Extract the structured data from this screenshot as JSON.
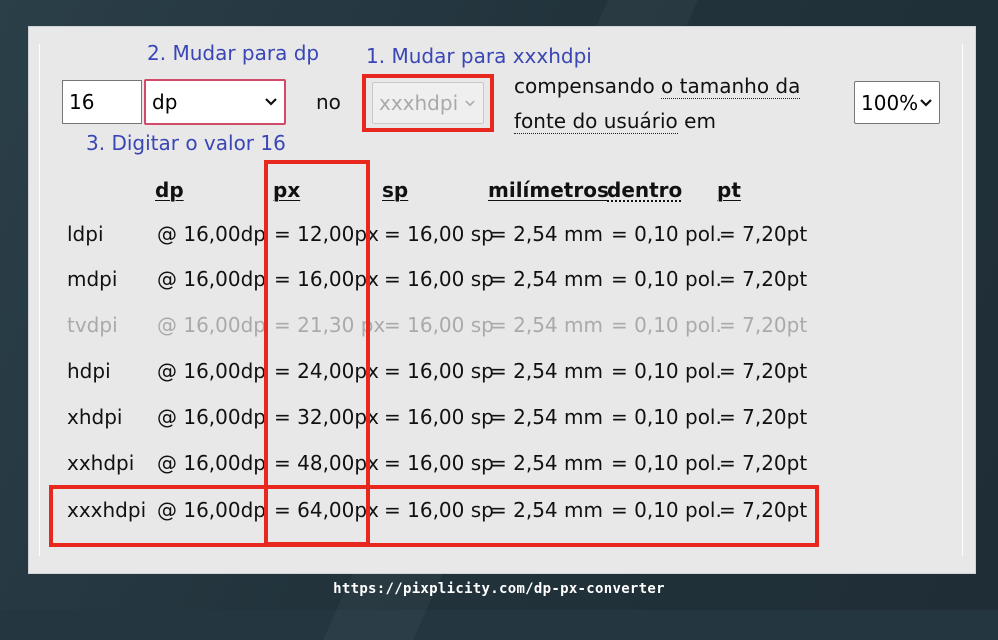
{
  "annotations": {
    "step1": "1. Mudar para xxxhdpi",
    "step2": "2. Mudar para dp",
    "step3": "3. Digitar o valor 16"
  },
  "converter": {
    "value_input": "16",
    "unit_select": {
      "selected": "dp"
    },
    "word_no": "no",
    "density_select": {
      "selected": "xxxhdpi"
    },
    "compensating_prefix": "compensando ",
    "compensating_link": "o tamanho da fonte do usuário",
    "compensating_suffix": " em",
    "zoom_select": {
      "selected": "100%"
    }
  },
  "table": {
    "headers": {
      "dp": "dp",
      "px": "px",
      "sp": "sp",
      "mm": "milímetros",
      "inches": "dentro",
      "pt": "pt"
    },
    "rows": [
      {
        "name": "ldpi",
        "dp": "@ 16,00dp",
        "px": "= 12,00px",
        "sp": "= 16,00 sp",
        "mm": "= 2,54 mm",
        "in": "= 0,10 pol.",
        "pt": "= 7,20pt",
        "dimmed": false
      },
      {
        "name": "mdpi",
        "dp": "@ 16,00dp",
        "px": "= 16,00px",
        "sp": "= 16,00 sp",
        "mm": "= 2,54 mm",
        "in": "= 0,10 pol.",
        "pt": "= 7,20pt",
        "dimmed": false
      },
      {
        "name": "tvdpi",
        "dp": "@ 16,00dp",
        "px": "= 21,30 px",
        "sp": "= 16,00 sp",
        "mm": "= 2,54 mm",
        "in": "= 0,10 pol.",
        "pt": "= 7,20pt",
        "dimmed": true
      },
      {
        "name": "hdpi",
        "dp": "@ 16,00dp",
        "px": "= 24,00px",
        "sp": "= 16,00 sp",
        "mm": "= 2,54 mm",
        "in": "= 0,10 pol.",
        "pt": "= 7,20pt",
        "dimmed": false
      },
      {
        "name": "xhdpi",
        "dp": "@ 16,00dp",
        "px": "= 32,00px",
        "sp": "= 16,00 sp",
        "mm": "= 2,54 mm",
        "in": "= 0,10 pol.",
        "pt": "= 7,20pt",
        "dimmed": false
      },
      {
        "name": "xxhdpi",
        "dp": "@ 16,00dp",
        "px": "= 48,00px",
        "sp": "= 16,00 sp",
        "mm": "= 2,54 mm",
        "in": "= 0,10 pol.",
        "pt": "= 7,20pt",
        "dimmed": false
      },
      {
        "name": "xxxhdpi",
        "dp": "@ 16,00dp",
        "px": "= 64,00px",
        "sp": "= 16,00 sp",
        "mm": "= 2,54 mm",
        "in": "= 0,10 pol.",
        "pt": "= 7,20pt",
        "dimmed": false
      }
    ]
  },
  "footer": {
    "url": "https://pixplicity.com/dp-px-converter"
  },
  "colors": {
    "annotation_text": "#3a46b5",
    "highlight_box": "#e8271e",
    "unit_select_border": "#d24a6a",
    "panel_bg": "#e8e8e8",
    "page_bg": "#243640"
  }
}
